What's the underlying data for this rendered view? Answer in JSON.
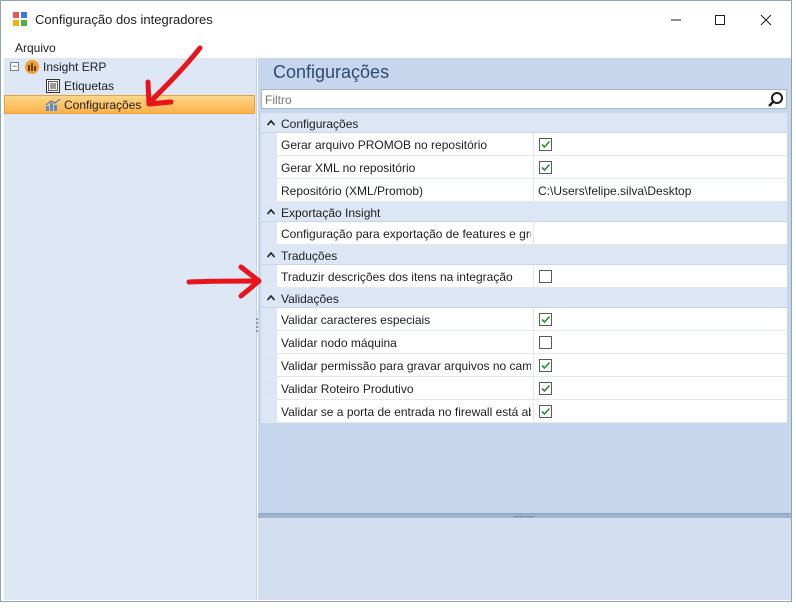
{
  "window": {
    "title": "Configuração dos integradores"
  },
  "menu": {
    "items": [
      "Arquivo"
    ]
  },
  "tree": {
    "root": {
      "label": "Insight ERP",
      "expander": "⊟"
    },
    "children": [
      {
        "label": "Etiquetas"
      },
      {
        "label": "Configurações",
        "selected": true
      }
    ]
  },
  "panel": {
    "title": "Configurações",
    "filter_placeholder": "Filtro"
  },
  "grid": {
    "categories": [
      {
        "label": "Configurações",
        "rows": [
          {
            "name": "Gerar arquivo PROMOB no repositório",
            "type": "checkbox",
            "checked": true
          },
          {
            "name": "Gerar XML no repositório",
            "type": "checkbox",
            "checked": true
          },
          {
            "name": "Repositório (XML/Promob)",
            "type": "text",
            "value": "C:\\Users\\felipe.silva\\Desktop"
          }
        ]
      },
      {
        "label": "Exportação Insight",
        "rows": [
          {
            "name": "Configuração para exportação de features e gru...",
            "type": "text",
            "value": ""
          }
        ]
      },
      {
        "label": "Traduções",
        "rows": [
          {
            "name": "Traduzir descrições dos itens na integração",
            "type": "checkbox",
            "checked": false
          }
        ]
      },
      {
        "label": "Validações",
        "rows": [
          {
            "name": "Validar caracteres especiais",
            "type": "checkbox",
            "checked": true
          },
          {
            "name": "Validar nodo máquina",
            "type": "checkbox",
            "checked": false
          },
          {
            "name": "Validar permissão para gravar arquivos no cami...",
            "type": "checkbox",
            "checked": true
          },
          {
            "name": "Validar Roteiro Produtivo",
            "type": "checkbox",
            "checked": true
          },
          {
            "name": "Validar se a porta de entrada no firewall está ab...",
            "type": "checkbox",
            "checked": true
          }
        ]
      }
    ]
  },
  "colors": {
    "accent": "#fbb24a",
    "check": "#2e8b2e",
    "annotation": "#e8131b"
  }
}
